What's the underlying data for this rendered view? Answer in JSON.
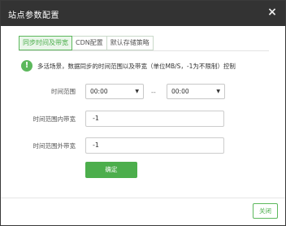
{
  "dialog": {
    "title": "站点参数配置",
    "close_icon": "×"
  },
  "tabs": [
    {
      "label": "同步时间及带宽",
      "active": true
    },
    {
      "label": "CDN配置",
      "active": false
    },
    {
      "label": "默认存储策略",
      "active": false
    }
  ],
  "info": {
    "icon": "info-icon",
    "icon_glyph": "!",
    "text": "多活场景，数据同步的时间范围以及带宽（单位MB/S，-1为不限制）控制"
  },
  "form": {
    "time_range": {
      "label": "时间范围",
      "start": "00:00",
      "separator": "--",
      "end": "00:00"
    },
    "inner_bandwidth": {
      "label": "时间范围内带宽",
      "value": "-1"
    },
    "outer_bandwidth": {
      "label": "时间范围外带宽",
      "value": "-1"
    },
    "confirm_label": "确定"
  },
  "footer": {
    "close_label": "关闭"
  },
  "colors": {
    "accent": "#4cae4c",
    "titlebar": "#333333"
  }
}
